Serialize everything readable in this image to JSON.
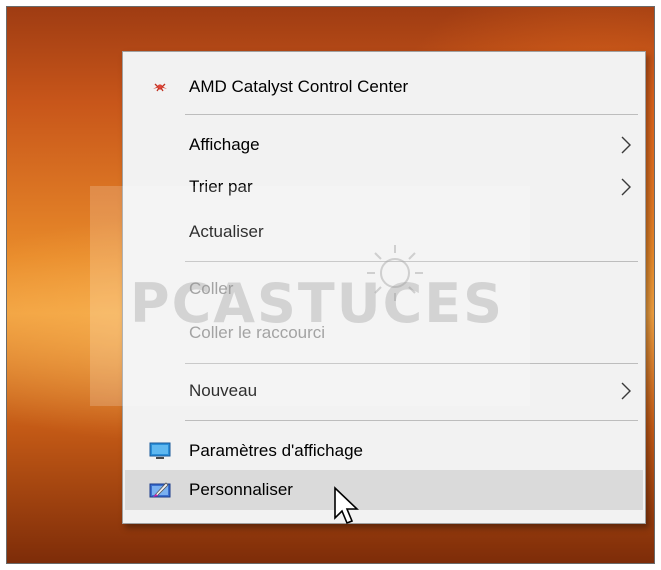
{
  "menu": {
    "amd": {
      "label": "AMD Catalyst Control Center",
      "icon": "amd-catalyst-icon"
    },
    "affichage": {
      "label": "Affichage",
      "has_submenu": true
    },
    "trier": {
      "label": "Trier par",
      "has_submenu": true
    },
    "actualiser": {
      "label": "Actualiser"
    },
    "coller": {
      "label": "Coller",
      "disabled": true
    },
    "coller_raccourci": {
      "label": "Coller le raccourci",
      "disabled": true
    },
    "nouveau": {
      "label": "Nouveau",
      "has_submenu": true
    },
    "parametres": {
      "label": "Paramètres d'affichage",
      "icon": "display-settings-icon"
    },
    "personnaliser": {
      "label": "Personnaliser",
      "icon": "personalize-icon",
      "hovered": true
    }
  },
  "watermark": {
    "text": "PCASTUCES"
  },
  "colors": {
    "menu_bg": "#f2f2f2",
    "hover_bg": "#dadada",
    "disabled_text": "#8f8f8f",
    "separator": "#bdbdbd"
  }
}
